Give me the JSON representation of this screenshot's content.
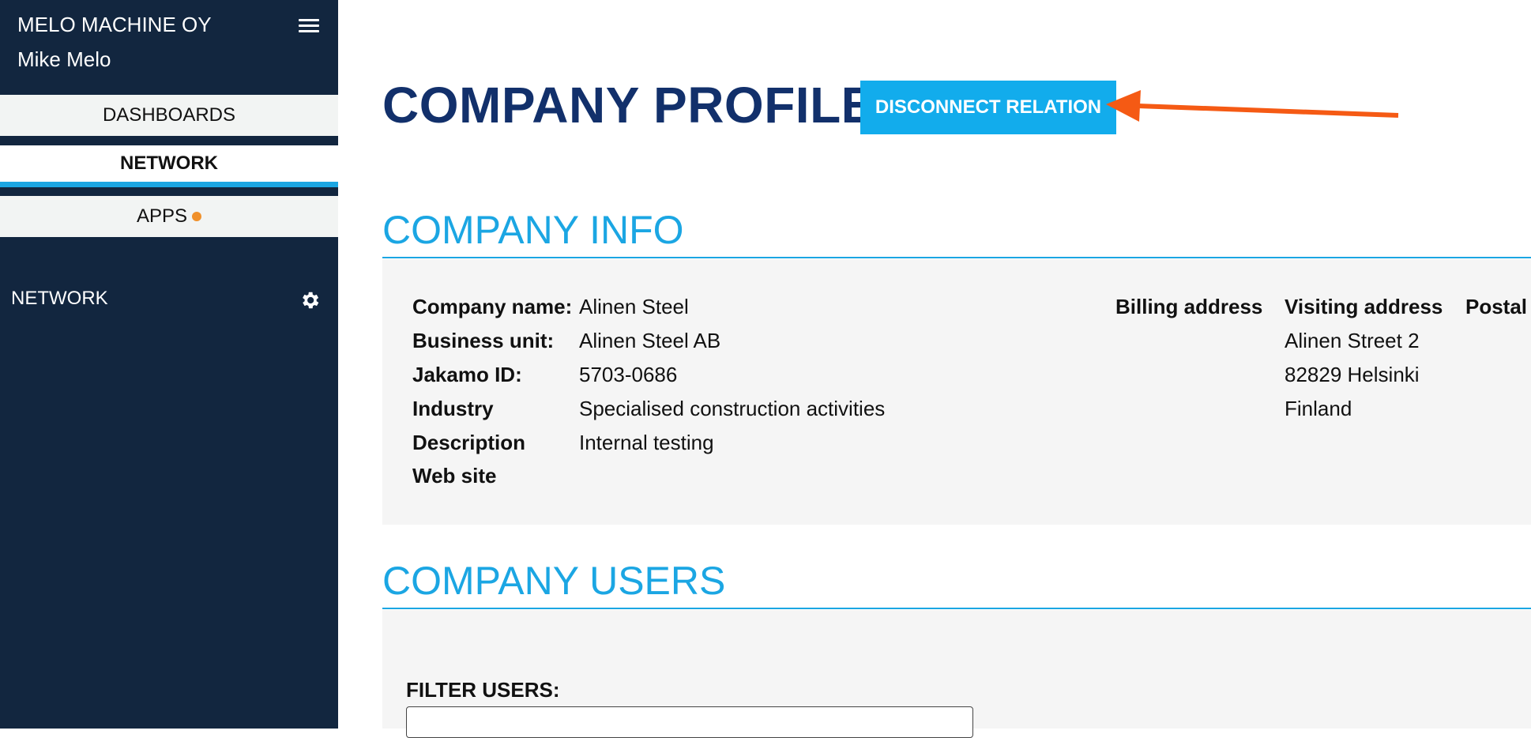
{
  "sidebar": {
    "org_name": "MELO MACHINE OY",
    "user_name": "Mike Melo",
    "nav": {
      "dashboards": "DASHBOARDS",
      "network": "NETWORK",
      "apps": "APPS"
    },
    "section_label": "NETWORK",
    "accent_color": "#1ba6e3",
    "notification_color": "#f0902a"
  },
  "header": {
    "title": "COMPANY PROFILE",
    "disconnect_label": "DISCONNECT RELATION"
  },
  "company_info": {
    "title": "COMPANY INFO",
    "fields": [
      {
        "label": "Company name:",
        "value": "Alinen Steel"
      },
      {
        "label": "Business unit:",
        "value": "Alinen Steel AB"
      },
      {
        "label": "Jakamo ID:",
        "value": "5703-0686"
      },
      {
        "label": "Industry",
        "value": "Specialised construction activities"
      },
      {
        "label": "Description",
        "value": "Internal testing"
      },
      {
        "label": "Web site",
        "value": ""
      }
    ],
    "address_headers": {
      "billing": "Billing address",
      "visiting": "Visiting address",
      "postal": "Postal"
    },
    "visiting_address": [
      "Alinen Street 2",
      "82829 Helsinki",
      "Finland"
    ]
  },
  "company_users": {
    "title": "COMPANY USERS",
    "filter_label": "FILTER USERS:",
    "filter_value": ""
  }
}
